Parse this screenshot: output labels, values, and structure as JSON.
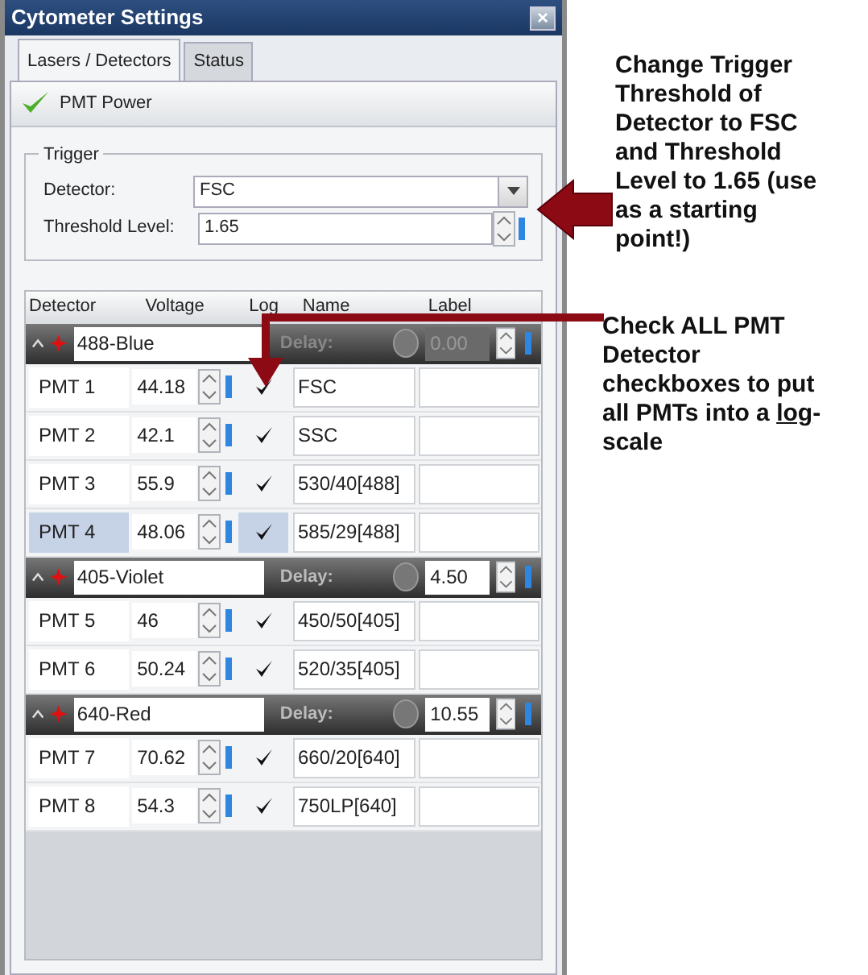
{
  "window": {
    "title": "Cytometer Settings",
    "close": "×"
  },
  "tabs": [
    {
      "label": "Lasers / Detectors",
      "selected": true
    },
    {
      "label": "Status",
      "selected": false
    }
  ],
  "pmt_power": {
    "label": "PMT Power",
    "checked": true
  },
  "trigger": {
    "legend": "Trigger",
    "detector_label": "Detector:",
    "detector_value": "FSC",
    "threshold_label": "Threshold Level:",
    "threshold_value": "1.65"
  },
  "table": {
    "columns": [
      "Detector",
      "Voltage",
      "Log",
      "Name",
      "Label"
    ],
    "groups": [
      {
        "laser": "488-Blue",
        "delay_label": "Delay:",
        "delay": "0.00",
        "disabled": true,
        "rows": [
          {
            "detector": "PMT 1",
            "voltage": "44.18",
            "log": true,
            "name": "FSC",
            "selected": false
          },
          {
            "detector": "PMT 2",
            "voltage": "42.1",
            "log": true,
            "name": "SSC",
            "selected": false
          },
          {
            "detector": "PMT 3",
            "voltage": "55.9",
            "log": true,
            "name": "530/40[488]",
            "selected": false
          },
          {
            "detector": "PMT 4",
            "voltage": "48.06",
            "log": true,
            "name": "585/29[488]",
            "selected": true
          }
        ]
      },
      {
        "laser": "405-Violet",
        "delay_label": "Delay:",
        "delay": "4.50",
        "disabled": false,
        "rows": [
          {
            "detector": "PMT 5",
            "voltage": "46",
            "log": true,
            "name": "450/50[405]",
            "selected": false
          },
          {
            "detector": "PMT 6",
            "voltage": "50.24",
            "log": true,
            "name": "520/35[405]",
            "selected": false
          }
        ]
      },
      {
        "laser": "640-Red",
        "delay_label": "Delay:",
        "delay": "10.55",
        "disabled": false,
        "rows": [
          {
            "detector": "PMT 7",
            "voltage": "70.62",
            "log": true,
            "name": "660/20[640]",
            "selected": false
          },
          {
            "detector": "PMT 8",
            "voltage": "54.3",
            "log": true,
            "name": "750LP[640]",
            "selected": false
          }
        ]
      }
    ]
  },
  "annotations": [
    {
      "text_before": "Change Trigger Threshold of Detector to FSC and Threshold Level to 1.65 (use as a starting point!)"
    },
    {
      "text_before": "Check ALL PMT Detector checkboxes to put all PMTs into a ",
      "underlined": "log",
      "text_after": "-scale"
    }
  ]
}
